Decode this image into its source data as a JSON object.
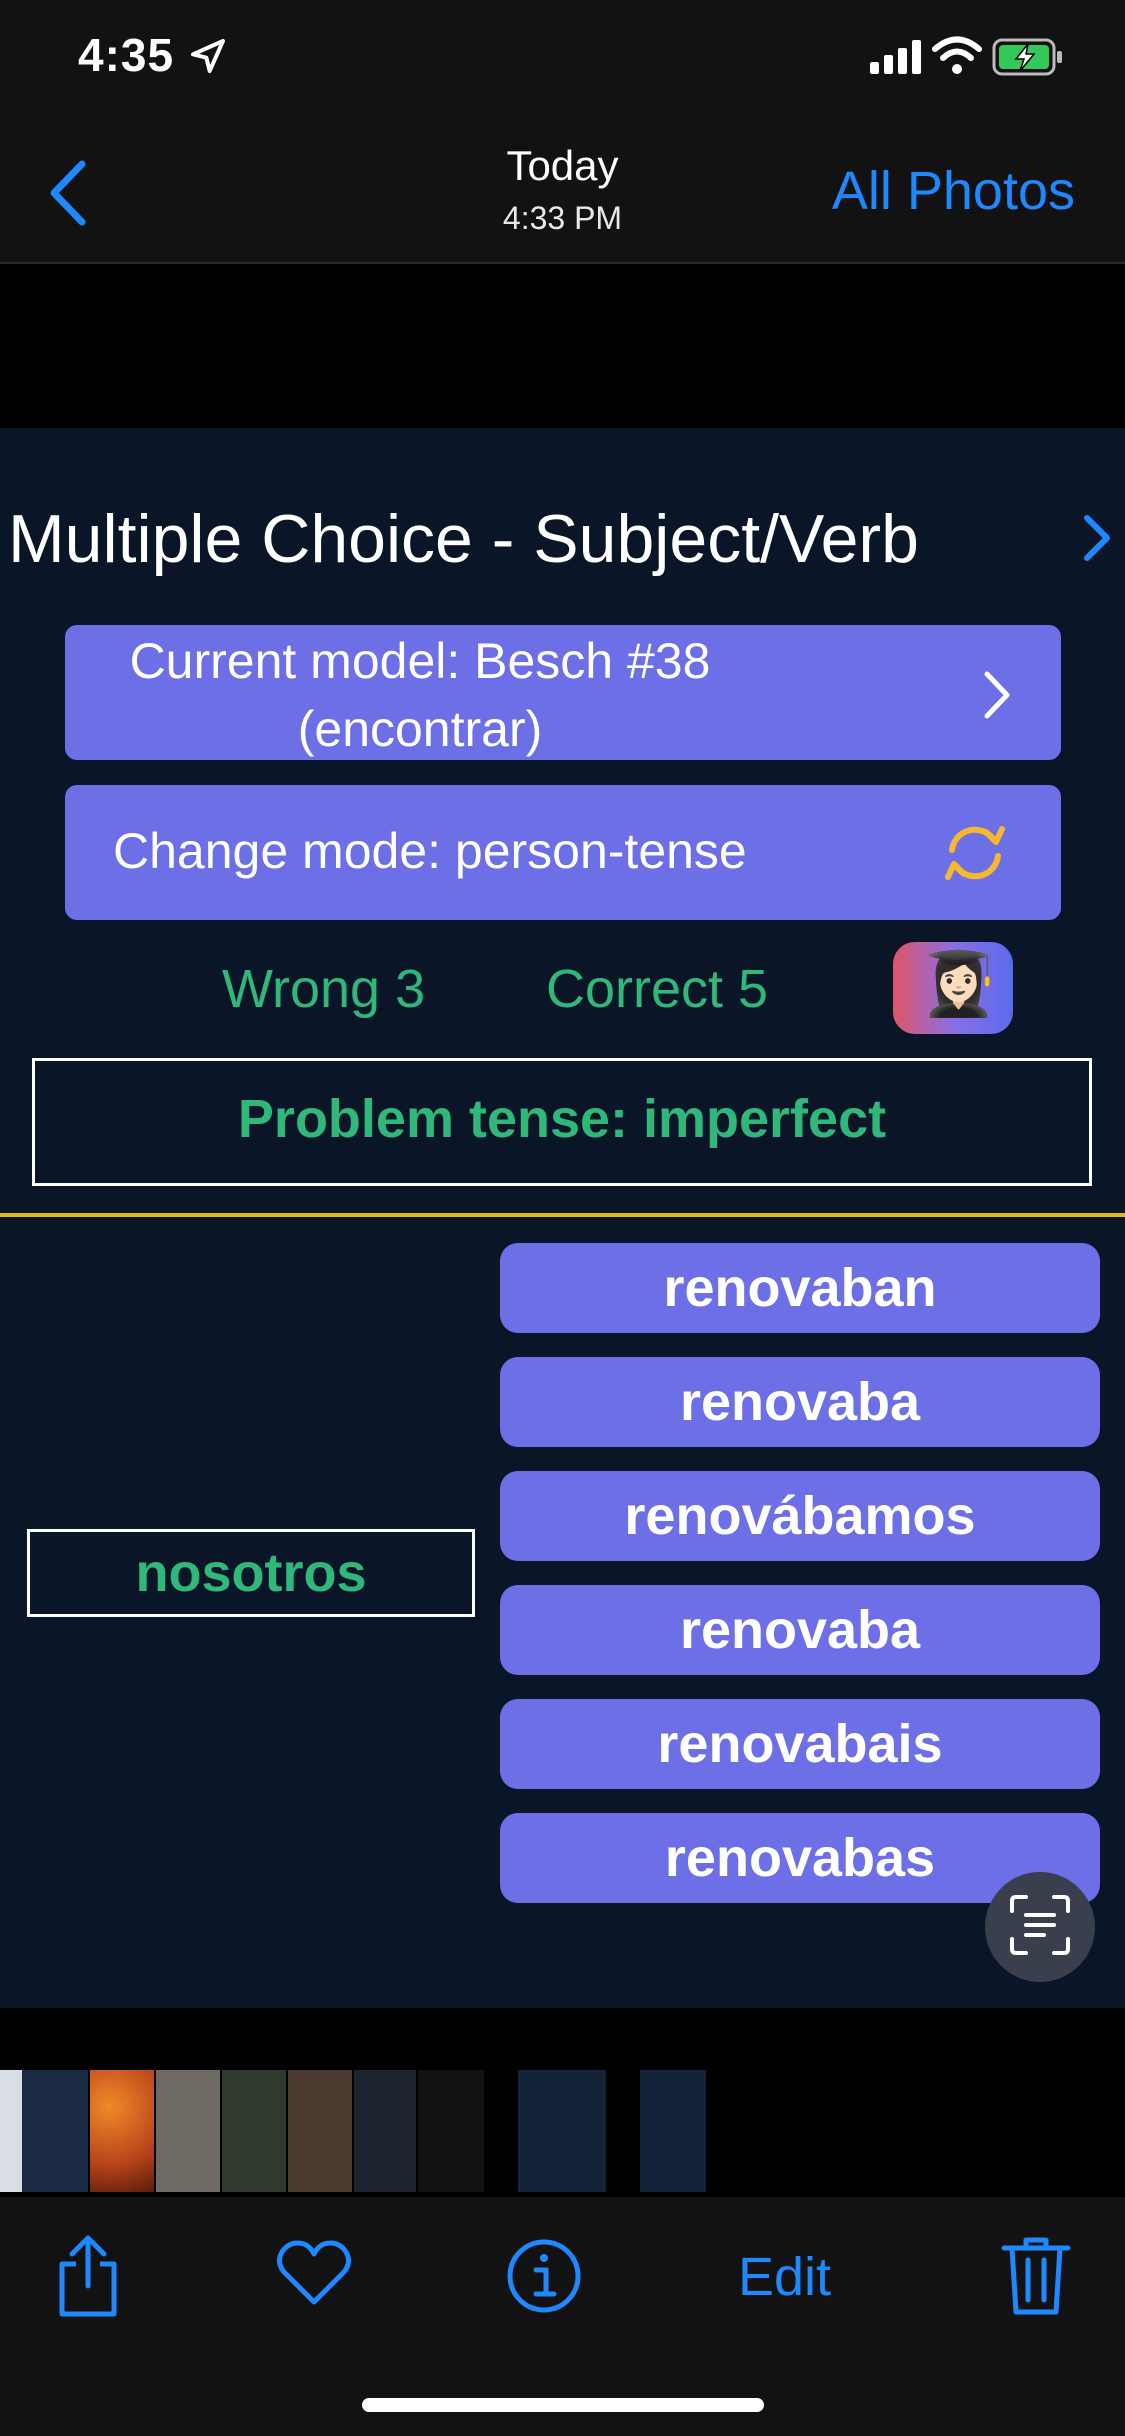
{
  "status_bar": {
    "time": "4:35"
  },
  "nav": {
    "date": "Today",
    "time": "4:33 PM",
    "all_photos": "All Photos"
  },
  "app": {
    "title": "Multiple Choice - Subject/Verb",
    "model_line1": "Current model: Besch #38",
    "model_line2": "(encontrar)",
    "mode_label": "Change mode: person-tense",
    "wrong": "Wrong 3",
    "correct": "Correct 5",
    "avatar_emoji": "👩🏻‍🎓",
    "problem_tense": "Problem tense: imperfect",
    "subject": "nosotros",
    "options": [
      "renovaban",
      "renovaba",
      "renovábamos",
      "renovaba",
      "renovabais",
      "renovabas"
    ]
  },
  "toolbar": {
    "edit": "Edit"
  },
  "colors": {
    "accent": "#1e88ff",
    "pill": "#6c6fe6",
    "green": "#2fb87a",
    "gold": "#e6b62a",
    "bg": "#0a1628"
  },
  "icons": [
    "location-arrow-icon",
    "cellular-icon",
    "wifi-icon",
    "battery-charging-icon",
    "back-chevron-icon",
    "chevron-right-icon",
    "refresh-icon",
    "live-text-scan-icon",
    "share-icon",
    "heart-icon",
    "info-icon",
    "trash-icon"
  ]
}
